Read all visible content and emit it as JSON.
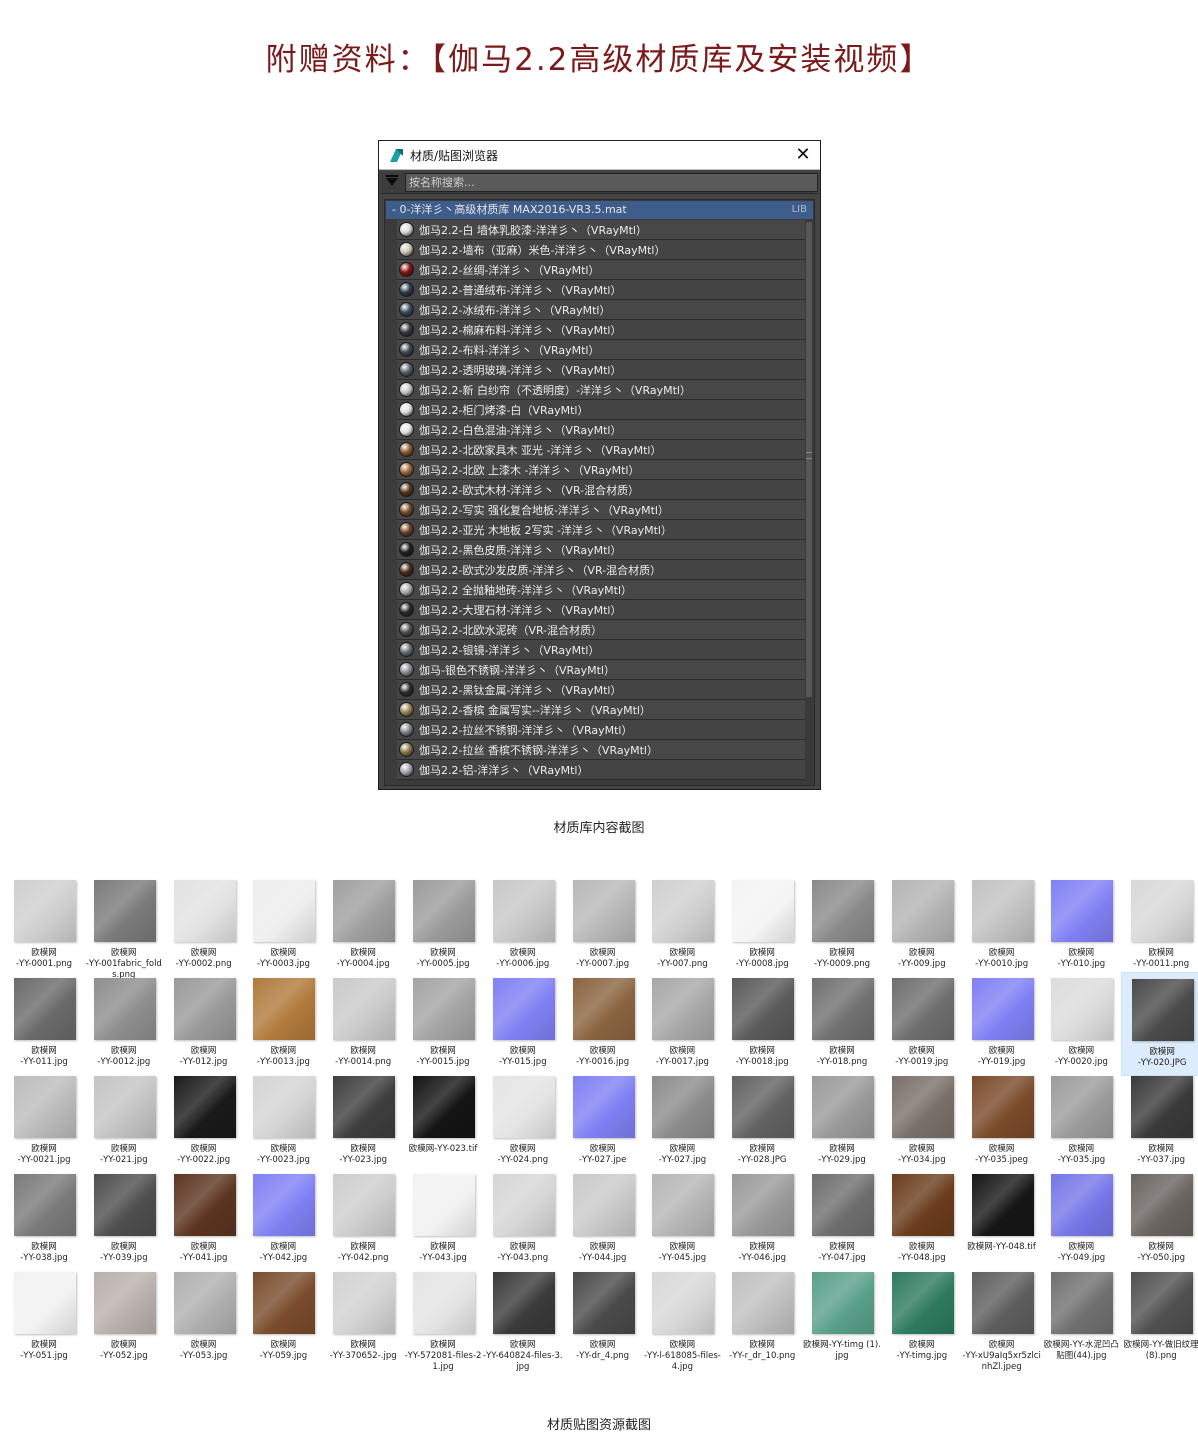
{
  "page": {
    "title": "附赠资料：【伽马2.2高级材质库及安装视频】",
    "caption_library": "材质库内容截图",
    "caption_textures": "材质贴图资源截图"
  },
  "browser": {
    "window_title": "材质/贴图浏览器",
    "search_placeholder": "按名称搜索...",
    "library_name": "- 0-洋洋彡丶高级材质库  MAX2016-VR3.5.mat",
    "library_tag": "LIB",
    "materials": [
      {
        "label": "伽马2.2-白 墙体乳胶漆-洋洋彡丶（VRayMtl）",
        "color": "#d8d8d8"
      },
      {
        "label": "伽马2.2-墙布（亚麻）米色-洋洋彡丶（VRayMtl）",
        "color": "#c9c3b6"
      },
      {
        "label": "伽马2.2-丝绸-洋洋彡丶（VRayMtl）",
        "color": "#8b0f0f"
      },
      {
        "label": "伽马2.2-普通绒布-洋洋彡丶（VRayMtl）",
        "color": "#2d3f4c"
      },
      {
        "label": "伽马2.2-冰绒布-洋洋彡丶（VRayMtl）",
        "color": "#3d4a5e"
      },
      {
        "label": "伽马2.2-棉麻布料-洋洋彡丶（VRayMtl）",
        "color": "#35383e"
      },
      {
        "label": "伽马2.2-布料-洋洋彡丶（VRayMtl）",
        "color": "#404654"
      },
      {
        "label": "伽马2.2-透明玻璃-洋洋彡丶（VRayMtl）",
        "color": "#58606a"
      },
      {
        "label": "伽马2.2-新 白纱帘（不透明度）-洋洋彡丶（VRayMtl）",
        "color": "#c4c4c4"
      },
      {
        "label": "伽马2.2-柜门烤漆-白（VRayMtl）",
        "color": "#dddddd"
      },
      {
        "label": "伽马2.2-白色混油-洋洋彡丶（VRayMtl）",
        "color": "#e0e0e0"
      },
      {
        "label": "伽马2.2-北欧家具木 亚光 -洋洋彡丶（VRayMtl）",
        "color": "#8a5a30"
      },
      {
        "label": "伽马2.2-北欧 上漆木 -洋洋彡丶（VRayMtl）",
        "color": "#9a6636"
      },
      {
        "label": "伽马2.2-欧式木材-洋洋彡丶（VR-混合材质）",
        "color": "#5a3518"
      },
      {
        "label": "伽马2.2-写实 强化复合地板-洋洋彡丶（VRayMtl）",
        "color": "#7a4c26"
      },
      {
        "label": "伽马2.2-亚光 木地板 2写实 -洋洋彡丶（VRayMtl）",
        "color": "#6e4422"
      },
      {
        "label": "伽马2.2-黑色皮质-洋洋彡丶（VRayMtl）",
        "color": "#1e1e1e"
      },
      {
        "label": "伽马2.2-欧式沙发皮质-洋洋彡丶（VR-混合材质）",
        "color": "#4a2a1a"
      },
      {
        "label": "伽马2.2 全抛釉地砖-洋洋彡丶（VRayMtl）",
        "color": "#a8a8a8"
      },
      {
        "label": "伽马2.2-大理石材-洋洋彡丶（VRayMtl）",
        "color": "#2a2a2a"
      },
      {
        "label": "伽马2.2-北欧水泥砖（VR-混合材质）",
        "color": "#505050"
      },
      {
        "label": "伽马2.2-银镜-洋洋彡丶（VRayMtl）",
        "color": "#6a7078"
      },
      {
        "label": "伽马-银色不锈钢-洋洋彡丶（VRayMtl）",
        "color": "#8a8f96"
      },
      {
        "label": "伽马2.2-黑钛金属-洋洋彡丶（VRayMtl）",
        "color": "#2c2c2c"
      },
      {
        "label": "伽马2.2-香槟 金属写实--洋洋彡丶（VRayMtl）",
        "color": "#9a8458"
      },
      {
        "label": "伽马2.2-拉丝不锈钢-洋洋彡丶（VRayMtl）",
        "color": "#7e8288"
      },
      {
        "label": "伽马2.2-拉丝 香槟不锈钢-洋洋彡丶（VRayMtl）",
        "color": "#8c7448"
      },
      {
        "label": "伽马2.2-铝-洋洋彡丶（VRayMtl）",
        "color": "#a2a6ac"
      }
    ]
  },
  "textures": [
    {
      "name": "欧模网\n-YY-0001.png",
      "color": "#cfcfcf"
    },
    {
      "name": "欧模网\n-YY-001fabric_folds.png",
      "color": "#7a7a7a"
    },
    {
      "name": "欧模网\n-YY-0002.png",
      "color": "#e2e2e2"
    },
    {
      "name": "欧模网\n-YY-0003.jpg",
      "color": "#eeeeee"
    },
    {
      "name": "欧模网\n-YY-0004.jpg",
      "color": "#a0a0a0"
    },
    {
      "name": "欧模网\n-YY-0005.jpg",
      "color": "#9c9c9c"
    },
    {
      "name": "欧模网\n-YY-0006.jpg",
      "color": "#c8c8c8"
    },
    {
      "name": "欧模网\n-YY-0007.jpg",
      "color": "#b8b8b8"
    },
    {
      "name": "欧模网\n-YY-007.png",
      "color": "#d0d0d0"
    },
    {
      "name": "欧模网\n-YY-0008.jpg",
      "color": "#f4f4f4"
    },
    {
      "name": "欧模网\n-YY-0009.png",
      "color": "#8a8a8a"
    },
    {
      "name": "欧模网\n-YY-009.jpg",
      "color": "#b4b4b4"
    },
    {
      "name": "欧模网\n-YY-0010.jpg",
      "color": "#c2c2c2"
    },
    {
      "name": "欧模网\n-YY-010.jpg",
      "color": "#8080f4"
    },
    {
      "name": "欧模网\n-YY-0011.png",
      "color": "#d8d8d8"
    },
    {
      "name": "欧模网\n-YY-011.jpg",
      "color": "#6a6a6a"
    },
    {
      "name": "欧模网\n-YY-0012.jpg",
      "color": "#8e8e8e"
    },
    {
      "name": "欧模网\n-YY-012.jpg",
      "color": "#9a9a9a"
    },
    {
      "name": "欧模网\n-YY-0013.jpg",
      "color": "#b07a3c"
    },
    {
      "name": "欧模网\n-YY-0014.png",
      "color": "#cacaca"
    },
    {
      "name": "欧模网\n-YY-0015.jpg",
      "color": "#a4a4a4"
    },
    {
      "name": "欧模网\n-YY-015.jpg",
      "color": "#8080f4"
    },
    {
      "name": "欧模网\n-YY-0016.jpg",
      "color": "#8a6440"
    },
    {
      "name": "欧模网\n-YY-0017.jpg",
      "color": "#a8a8a8"
    },
    {
      "name": "欧模网\n-YY-0018.jpg",
      "color": "#5a5a5a"
    },
    {
      "name": "欧模网\n-YY-018.png",
      "color": "#707070"
    },
    {
      "name": "欧模网\n-YY-0019.jpg",
      "color": "#6e6e6e"
    },
    {
      "name": "欧模网\n-YY-019.jpg",
      "color": "#8080f4"
    },
    {
      "name": "欧模网\n-YY-0020.jpg",
      "color": "#dcdcdc"
    },
    {
      "name": "欧模网\n-YY-020.JPG",
      "color": "#4a4a4a"
    },
    {
      "name": "欧模网\n-YY-0021.jpg",
      "color": "#bcbcbc"
    },
    {
      "name": "欧模网\n-YY-021.jpg",
      "color": "#c4c4c4"
    },
    {
      "name": "欧模网\n-YY-0022.jpg",
      "color": "#1a1a1a"
    },
    {
      "name": "欧模网\n-YY-0023.jpg",
      "color": "#d4d4d4"
    },
    {
      "name": "欧模网\n-YY-023.jpg",
      "color": "#3e3e3e"
    },
    {
      "name": "欧模网-YY-023.tif",
      "color": "#141414"
    },
    {
      "name": "欧模网\n-YY-024.png",
      "color": "#e4e4e4"
    },
    {
      "name": "欧模网\n-YY-027.jpe",
      "color": "#8080f4"
    },
    {
      "name": "欧模网\n-YY-027.jpg",
      "color": "#8c8c8c"
    },
    {
      "name": "欧模网\n-YY-028.JPG",
      "color": "#626262"
    },
    {
      "name": "欧模网\n-YY-029.jpg",
      "color": "#9a9a9a"
    },
    {
      "name": "欧模网\n-YY-034.jpg",
      "color": "#7a706a"
    },
    {
      "name": "欧模网\n-YY-035.jpeg",
      "color": "#7a4a2a"
    },
    {
      "name": "欧模网\n-YY-035.jpg",
      "color": "#9c9c9c"
    },
    {
      "name": "欧模网\n-YY-037.jpg",
      "color": "#3a3a3a"
    },
    {
      "name": "欧模网\n-YY-038.jpg",
      "color": "#7a7a7a"
    },
    {
      "name": "欧模网\n-YY-039.jpg",
      "color": "#4e4e4e"
    },
    {
      "name": "欧模网\n-YY-041.jpg",
      "color": "#5c3420"
    },
    {
      "name": "欧模网\n-YY-042.jpg",
      "color": "#8080f4"
    },
    {
      "name": "欧模网\n-YY-042.png",
      "color": "#cecece"
    },
    {
      "name": "欧模网\n-YY-043.jpg",
      "color": "#f2f2f2"
    },
    {
      "name": "欧模网\n-YY-043.png",
      "color": "#d6d6d6"
    },
    {
      "name": "欧模网\n-YY-044.jpg",
      "color": "#cacaca"
    },
    {
      "name": "欧模网\n-YY-045.jpg",
      "color": "#b6b6b6"
    },
    {
      "name": "欧模网\n-YY-046.jpg",
      "color": "#9a9a9a"
    },
    {
      "name": "欧模网\n-YY-047.jpg",
      "color": "#6e6e6e"
    },
    {
      "name": "欧模网\n-YY-048.jpg",
      "color": "#6a3c1c"
    },
    {
      "name": "欧模网-YY-048.tif",
      "color": "#161616"
    },
    {
      "name": "欧模网\n-YY-049.jpg",
      "color": "#7676e8"
    },
    {
      "name": "欧模网\n-YY-050.jpg",
      "color": "#6a6460"
    },
    {
      "name": "欧模网\n-YY-051.jpg",
      "color": "#f2f2f2"
    },
    {
      "name": "欧模网\n-YY-052.jpg",
      "color": "#b8b0ac"
    },
    {
      "name": "欧模网\n-YY-053.jpg",
      "color": "#b0b0b0"
    },
    {
      "name": "欧模网\n-YY-059.jpg",
      "color": "#7a4c2c"
    },
    {
      "name": "欧模网\n-YY-370652-.jpg",
      "color": "#d2d2d2"
    },
    {
      "name": "欧模网\n-YY-572081-files-21.jpg",
      "color": "#e4e4e4"
    },
    {
      "name": "欧模网\n-YY-640824-files-3.jpg",
      "color": "#3a3a3a"
    },
    {
      "name": "欧模网\n-YY-dr_4.png",
      "color": "#4a4a4a"
    },
    {
      "name": "欧模网\n-YY-l-618085-files-4.jpg",
      "color": "#d8d8d8"
    },
    {
      "name": "欧模网\n-YY-r_dr_10.png",
      "color": "#c0c0c0"
    },
    {
      "name": "欧模网-YY-timg (1).jpg",
      "color": "#5aa08a"
    },
    {
      "name": "欧模网\n-YY-timg.jpg",
      "color": "#2e7a5e"
    },
    {
      "name": "欧模网\n-YY-xU9aIq5xr5zlcinhZl.jpeg",
      "color": "#5e5e5e"
    },
    {
      "name": "欧模网-YY-水泥凹凸贴图(44).jpg",
      "color": "#707070"
    },
    {
      "name": "欧模网-YY-做旧纹理 (8).png",
      "color": "#505050"
    }
  ]
}
